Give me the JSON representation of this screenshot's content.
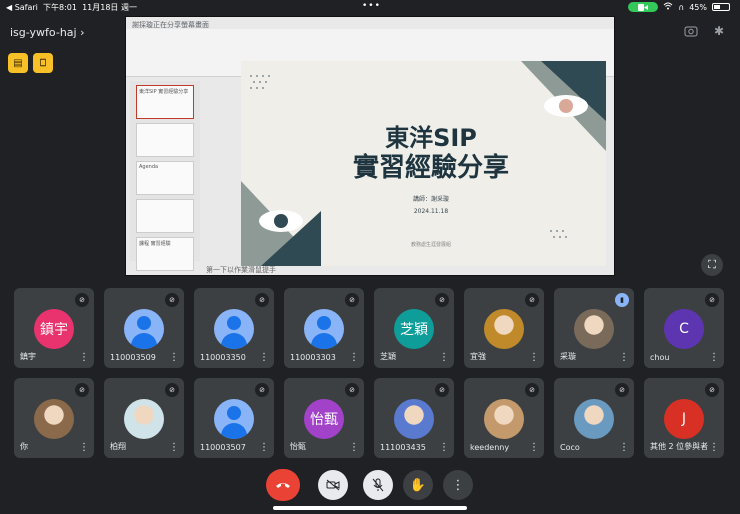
{
  "status_bar": {
    "back_app": "◀ Safari",
    "time": "下午8:01",
    "date": "11月18日 週一",
    "battery": "45%"
  },
  "meeting": {
    "code": "isg-ywfo-haj",
    "code_chevron": "›"
  },
  "shared_screen": {
    "window_title": "謝採璇正在分享螢幕畫面",
    "slide": {
      "title_line1": "東洋SIP",
      "title_line2": "實習經驗分享",
      "speaker": "講師：謝采璇",
      "date": "2024.11.18",
      "footer": "教務處生涯發展組"
    },
    "status_text": "第一下以作業滑鼠提手",
    "thumbs": [
      "東洋SIP 實習經驗分享",
      "",
      "Agenda",
      "",
      "課程 實習經驗"
    ]
  },
  "participants": [
    {
      "name": "鎮宇",
      "avatar_type": "letter",
      "avatar_text": "鎮宇",
      "avatar_color": "#e8336e"
    },
    {
      "name": "110003509",
      "avatar_type": "generic"
    },
    {
      "name": "110003350",
      "avatar_type": "generic"
    },
    {
      "name": "110003303",
      "avatar_type": "generic"
    },
    {
      "name": "芝穎",
      "avatar_type": "letter",
      "avatar_text": "芝穎",
      "avatar_color": "#0f9d9a"
    },
    {
      "name": "宜強",
      "avatar_type": "photo",
      "avatar_color": "#c08a2a"
    },
    {
      "name": "采璇",
      "avatar_type": "photo",
      "avatar_color": "#7a6a5a",
      "speaking": true
    },
    {
      "name": "chou",
      "avatar_type": "letter",
      "avatar_text": "C",
      "avatar_color": "#5e35b1"
    },
    {
      "name": "你",
      "avatar_type": "photo",
      "avatar_color": "#8a6a4a"
    },
    {
      "name": "柏翔",
      "avatar_type": "photo",
      "avatar_color": "#cfe3e8"
    },
    {
      "name": "110003507",
      "avatar_type": "generic"
    },
    {
      "name": "怡甄",
      "avatar_type": "letter",
      "avatar_text": "怡甄",
      "avatar_color": "#a142c9"
    },
    {
      "name": "111003435",
      "avatar_type": "photo",
      "avatar_color": "#5a7ad0"
    },
    {
      "name": "keedenny",
      "avatar_type": "photo",
      "avatar_color": "#c49a6c"
    },
    {
      "name": "Coco",
      "avatar_type": "photo",
      "avatar_color": "#6a9ac0"
    },
    {
      "name": "其他 2 位參與者",
      "avatar_type": "letter",
      "avatar_text": "J",
      "avatar_color": "#d93025"
    }
  ],
  "controls": {
    "end_call": "end-call",
    "camera": "camera-off",
    "mic": "mic-off",
    "raise_hand": "raise-hand",
    "more": "more-options"
  },
  "colors": {
    "background": "#202124",
    "tile": "#3c4043",
    "end_call": "#ea4335",
    "generic_avatar": "#8ab4f8",
    "slide_title": "#1e3540"
  }
}
